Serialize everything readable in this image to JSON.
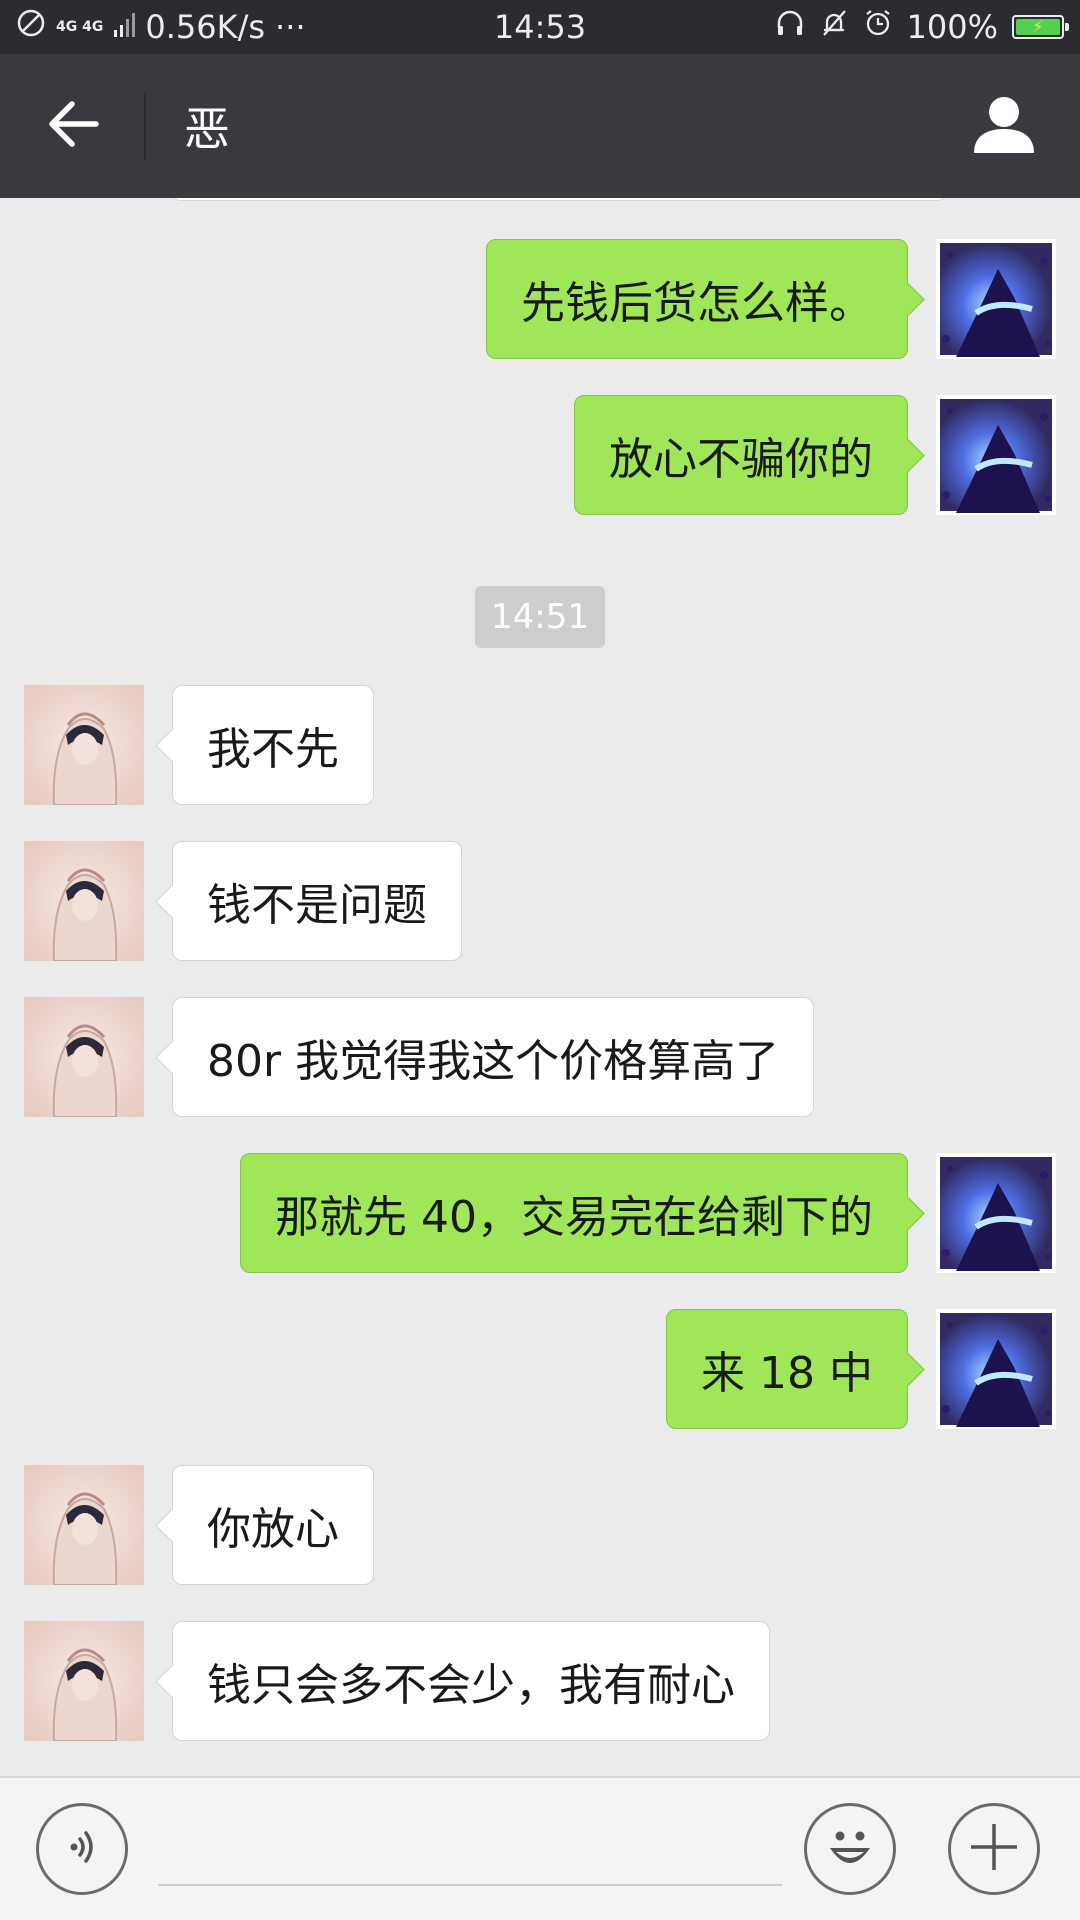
{
  "status_bar": {
    "network": "4G 4G",
    "speed": "0.56K/s",
    "more": "···",
    "time": "14:53",
    "battery": "100%",
    "battery_color": "#52d053"
  },
  "header": {
    "title": "恶",
    "back_icon": "back-arrow-icon",
    "profile_icon": "person-icon",
    "background": "#393a3f"
  },
  "chat": {
    "timestamp": "14:51",
    "messages": [
      {
        "side": "out",
        "text": "先钱后货怎么样。"
      },
      {
        "side": "out",
        "text": "放心不骗你的"
      },
      {
        "side": "in",
        "text": "我不先"
      },
      {
        "side": "in",
        "text": "钱不是问题"
      },
      {
        "side": "in",
        "text": "80r 我觉得我这个价格算高了"
      },
      {
        "side": "out",
        "text": "那就先 40，交易完在给剩下的"
      },
      {
        "side": "out",
        "text": "来 18 中"
      },
      {
        "side": "in",
        "text": "你放心"
      },
      {
        "side": "in",
        "text": "钱只会多不会少，我有耐心"
      }
    ],
    "outgoing_bubble_color": "#9fe658",
    "incoming_bubble_color": "#ffffff"
  },
  "input_bar": {
    "voice_icon": "voice-icon",
    "emoji_icon": "emoji-icon",
    "plus_icon": "plus-icon",
    "text_value": ""
  }
}
